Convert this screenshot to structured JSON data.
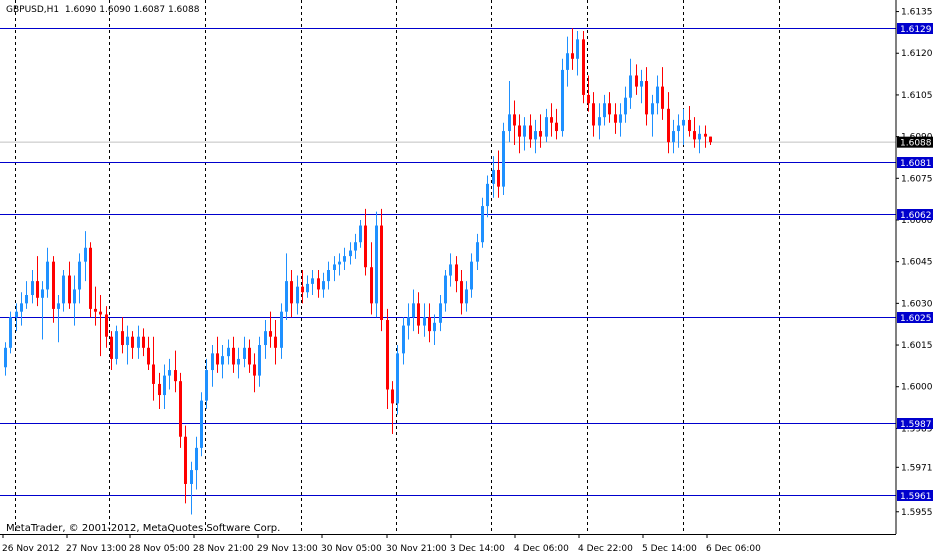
{
  "header": {
    "symbol": "GBPUSD,H1",
    "ohlc": "1.6090 1.6090 1.6087 1.6088"
  },
  "footer": {
    "copyright": "MetaTrader, © 2001-2012, MetaQuotes Software Corp."
  },
  "colors": {
    "bull": "#1e90ff",
    "bear": "#ff0000",
    "hline": "#0000cd",
    "grid": "#000000",
    "price_marker_bg": "#000000",
    "level_marker_bg": "#0000cd"
  },
  "chart_data": {
    "type": "candlestick",
    "title": "GBPUSD,H1",
    "ylim": [
      1.5947,
      1.6137
    ],
    "grid": true,
    "y_ticks": [
      "1.6135",
      "1.6120",
      "1.6105",
      "1.6090",
      "1.6075",
      "1.6060",
      "1.6045",
      "1.6030",
      "1.6015",
      "1.6000",
      "1.5985",
      "1.5971",
      "1.5955"
    ],
    "x_ticks": [
      "26 Nov 2012",
      "27 Nov 13:00",
      "28 Nov 05:00",
      "28 Nov 21:00",
      "29 Nov 13:00",
      "30 Nov 05:00",
      "30 Nov 21:00",
      "3 Dec 14:00",
      "4 Dec 06:00",
      "4 Dec 22:00",
      "5 Dec 14:00",
      "6 Dec 06:00"
    ],
    "horizontal_levels": [
      "1.6129",
      "1.6081",
      "1.6062",
      "1.6025",
      "1.5987",
      "1.5961"
    ],
    "current_price": "1.6088",
    "candles": [
      [
        1.6007,
        1.6016,
        1.6004,
        1.6014
      ],
      [
        1.6014,
        1.6027,
        1.6012,
        1.6025
      ],
      [
        1.6025,
        1.603,
        1.602,
        1.6027
      ],
      [
        1.6027,
        1.6034,
        1.6022,
        1.603
      ],
      [
        1.603,
        1.6038,
        1.6028,
        1.6033
      ],
      [
        1.6033,
        1.6042,
        1.603,
        1.6038
      ],
      [
        1.6038,
        1.6047,
        1.6029,
        1.6032
      ],
      [
        1.6032,
        1.6038,
        1.6017,
        1.6035
      ],
      [
        1.6035,
        1.605,
        1.6032,
        1.6045
      ],
      [
        1.6045,
        1.6047,
        1.6023,
        1.6028
      ],
      [
        1.6028,
        1.6033,
        1.6016,
        1.603
      ],
      [
        1.603,
        1.6042,
        1.6027,
        1.604
      ],
      [
        1.604,
        1.6045,
        1.6028,
        1.603
      ],
      [
        1.603,
        1.604,
        1.6022,
        1.6035
      ],
      [
        1.6035,
        1.6048,
        1.603,
        1.6045
      ],
      [
        1.6045,
        1.6056,
        1.6038,
        1.605
      ],
      [
        1.605,
        1.6052,
        1.6025,
        1.6028
      ],
      [
        1.6028,
        1.6036,
        1.6022,
        1.6027
      ],
      [
        1.6027,
        1.6033,
        1.6011,
        1.6026
      ],
      [
        1.6026,
        1.6029,
        1.6014,
        1.6018
      ],
      [
        1.6018,
        1.602,
        1.6006,
        1.601
      ],
      [
        1.601,
        1.6022,
        1.6008,
        1.602
      ],
      [
        1.602,
        1.6025,
        1.6012,
        1.6015
      ],
      [
        1.6015,
        1.6022,
        1.6008,
        1.6018
      ],
      [
        1.6018,
        1.602,
        1.601,
        1.6014
      ],
      [
        1.6014,
        1.6022,
        1.601,
        1.6018
      ],
      [
        1.6018,
        1.6021,
        1.6011,
        1.6014
      ],
      [
        1.6014,
        1.6018,
        1.6006,
        1.6008
      ],
      [
        1.6008,
        1.6018,
        1.5995,
        1.6001
      ],
      [
        1.6001,
        1.6005,
        1.5992,
        1.5997
      ],
      [
        1.5997,
        1.6008,
        1.5992,
        1.6004
      ],
      [
        1.6004,
        1.601,
        1.5999,
        1.6006
      ],
      [
        1.6006,
        1.6013,
        1.5998,
        1.6002
      ],
      [
        1.6002,
        1.6005,
        1.5978,
        1.5982
      ],
      [
        1.5982,
        1.5986,
        1.5958,
        1.5965
      ],
      [
        1.5965,
        1.5973,
        1.5954,
        1.597
      ],
      [
        1.597,
        1.5982,
        1.5963,
        1.5978
      ],
      [
        1.5978,
        1.5998,
        1.5975,
        1.5995
      ],
      [
        1.5995,
        1.601,
        1.5992,
        1.6006
      ],
      [
        1.6006,
        1.6015,
        1.6,
        1.6012
      ],
      [
        1.6012,
        1.6018,
        1.6005,
        1.6008
      ],
      [
        1.6008,
        1.6015,
        1.6003,
        1.6011
      ],
      [
        1.6011,
        1.6017,
        1.6008,
        1.6014
      ],
      [
        1.6014,
        1.6018,
        1.6005,
        1.6008
      ],
      [
        1.6008,
        1.6014,
        1.6003,
        1.601
      ],
      [
        1.601,
        1.6018,
        1.6007,
        1.6014
      ],
      [
        1.6014,
        1.6017,
        1.6005,
        1.6008
      ],
      [
        1.6008,
        1.6012,
        1.5998,
        1.6004
      ],
      [
        1.6004,
        1.6018,
        1.6,
        1.6015
      ],
      [
        1.6015,
        1.6024,
        1.601,
        1.602
      ],
      [
        1.602,
        1.6027,
        1.6014,
        1.6018
      ],
      [
        1.6018,
        1.6024,
        1.6008,
        1.6014
      ],
      [
        1.6014,
        1.603,
        1.601,
        1.6027
      ],
      [
        1.6027,
        1.6048,
        1.6024,
        1.6038
      ],
      [
        1.6038,
        1.6042,
        1.6025,
        1.603
      ],
      [
        1.603,
        1.604,
        1.6026,
        1.6036
      ],
      [
        1.6036,
        1.6042,
        1.603,
        1.6034
      ],
      [
        1.6034,
        1.604,
        1.6032,
        1.6037
      ],
      [
        1.6037,
        1.6042,
        1.6033,
        1.6039
      ],
      [
        1.6039,
        1.6042,
        1.6032,
        1.6035
      ],
      [
        1.6035,
        1.6041,
        1.6032,
        1.6038
      ],
      [
        1.6038,
        1.6045,
        1.6035,
        1.6042
      ],
      [
        1.6042,
        1.6047,
        1.6038,
        1.6044
      ],
      [
        1.6044,
        1.6048,
        1.604,
        1.6045
      ],
      [
        1.6045,
        1.605,
        1.6042,
        1.6047
      ],
      [
        1.6047,
        1.6052,
        1.6044,
        1.6049
      ],
      [
        1.6049,
        1.6055,
        1.6046,
        1.6052
      ],
      [
        1.6052,
        1.606,
        1.605,
        1.6058
      ],
      [
        1.6058,
        1.6064,
        1.604,
        1.6043
      ],
      [
        1.6043,
        1.6052,
        1.6026,
        1.603
      ],
      [
        1.603,
        1.6063,
        1.6025,
        1.6058
      ],
      [
        1.6058,
        1.6064,
        1.602,
        1.6024
      ],
      [
        1.6024,
        1.6028,
        1.5992,
        1.5999
      ],
      [
        1.5999,
        1.6002,
        1.5983,
        1.5994
      ],
      [
        1.5994,
        1.6015,
        1.599,
        1.6012
      ],
      [
        1.6012,
        1.6025,
        1.6008,
        1.6022
      ],
      [
        1.6022,
        1.603,
        1.6017,
        1.6025
      ],
      [
        1.6025,
        1.6035,
        1.602,
        1.603
      ],
      [
        1.603,
        1.6034,
        1.6019,
        1.6022
      ],
      [
        1.6022,
        1.603,
        1.6018,
        1.6025
      ],
      [
        1.6025,
        1.603,
        1.6016,
        1.602
      ],
      [
        1.602,
        1.6026,
        1.6015,
        1.6023
      ],
      [
        1.6023,
        1.6033,
        1.602,
        1.603
      ],
      [
        1.603,
        1.6042,
        1.6027,
        1.604
      ],
      [
        1.604,
        1.6048,
        1.6036,
        1.6044
      ],
      [
        1.6044,
        1.6047,
        1.6034,
        1.6038
      ],
      [
        1.6038,
        1.6042,
        1.6026,
        1.603
      ],
      [
        1.603,
        1.6038,
        1.6027,
        1.6035
      ],
      [
        1.6035,
        1.6048,
        1.6032,
        1.6045
      ],
      [
        1.6045,
        1.6055,
        1.6042,
        1.6052
      ],
      [
        1.6052,
        1.6068,
        1.605,
        1.6065
      ],
      [
        1.6065,
        1.6076,
        1.6061,
        1.6073
      ],
      [
        1.6073,
        1.6083,
        1.6068,
        1.6078
      ],
      [
        1.6078,
        1.6085,
        1.6068,
        1.6072
      ],
      [
        1.6072,
        1.6095,
        1.6069,
        1.6092
      ],
      [
        1.6092,
        1.611,
        1.6088,
        1.6098
      ],
      [
        1.6098,
        1.6103,
        1.6087,
        1.6094
      ],
      [
        1.6094,
        1.6098,
        1.6084,
        1.609
      ],
      [
        1.609,
        1.6097,
        1.6085,
        1.6094
      ],
      [
        1.6094,
        1.6098,
        1.6086,
        1.6089
      ],
      [
        1.6089,
        1.6096,
        1.6084,
        1.6092
      ],
      [
        1.6092,
        1.6098,
        1.6086,
        1.609
      ],
      [
        1.609,
        1.61,
        1.6088,
        1.6097
      ],
      [
        1.6097,
        1.6102,
        1.609,
        1.6095
      ],
      [
        1.6095,
        1.61,
        1.6089,
        1.6092
      ],
      [
        1.6092,
        1.6118,
        1.609,
        1.6114
      ],
      [
        1.6114,
        1.6126,
        1.6108,
        1.612
      ],
      [
        1.612,
        1.6129,
        1.6114,
        1.6118
      ],
      [
        1.6118,
        1.6128,
        1.6112,
        1.6125
      ],
      [
        1.6125,
        1.6128,
        1.6102,
        1.6105
      ],
      [
        1.6105,
        1.6112,
        1.6099,
        1.6102
      ],
      [
        1.6102,
        1.6106,
        1.609,
        1.6094
      ],
      [
        1.6094,
        1.6102,
        1.6089,
        1.6097
      ],
      [
        1.6097,
        1.6105,
        1.6094,
        1.6102
      ],
      [
        1.6102,
        1.6106,
        1.6095,
        1.6098
      ],
      [
        1.6098,
        1.6102,
        1.6091,
        1.6095
      ],
      [
        1.6095,
        1.6102,
        1.609,
        1.6098
      ],
      [
        1.6098,
        1.6108,
        1.6095,
        1.6104
      ],
      [
        1.6104,
        1.6118,
        1.61,
        1.6112
      ],
      [
        1.6112,
        1.6116,
        1.6105,
        1.6108
      ],
      [
        1.6108,
        1.6114,
        1.6102,
        1.611
      ],
      [
        1.611,
        1.6115,
        1.6094,
        1.6098
      ],
      [
        1.6098,
        1.6105,
        1.609,
        1.6102
      ],
      [
        1.6102,
        1.6112,
        1.6098,
        1.6108
      ],
      [
        1.6108,
        1.6115,
        1.6096,
        1.61
      ],
      [
        1.61,
        1.6106,
        1.6084,
        1.6088
      ],
      [
        1.6088,
        1.6096,
        1.6084,
        1.6092
      ],
      [
        1.6092,
        1.6098,
        1.6086,
        1.6094
      ],
      [
        1.6094,
        1.61,
        1.6087,
        1.6096
      ],
      [
        1.6096,
        1.6101,
        1.609,
        1.6092
      ],
      [
        1.6092,
        1.6097,
        1.6086,
        1.6089
      ],
      [
        1.6089,
        1.6094,
        1.6084,
        1.6091
      ],
      [
        1.6091,
        1.6094,
        1.6086,
        1.609
      ],
      [
        1.609,
        1.609,
        1.6087,
        1.6088
      ]
    ]
  }
}
